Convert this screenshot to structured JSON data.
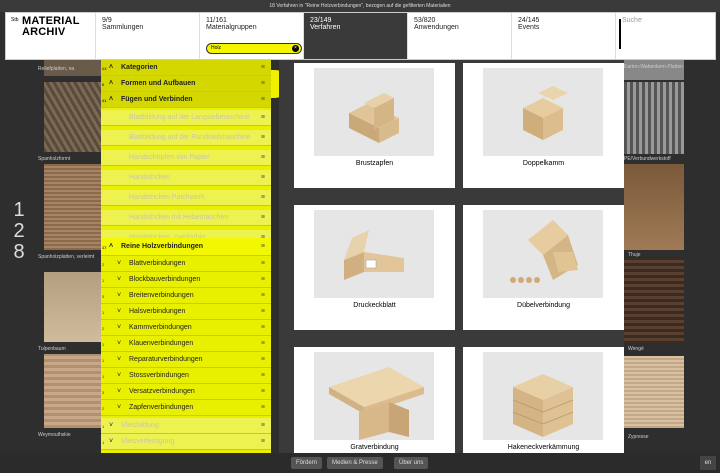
{
  "topbar": {
    "text": "18 Verfahren in \"Reine Holzverbindungen\", bezogen auf die gefilterten Materialien"
  },
  "logo": {
    "num": "Stb",
    "line1": "MATERIAL",
    "line2": "ARCHIV"
  },
  "nav": [
    {
      "count": "9/9",
      "label": "Sammlungen"
    },
    {
      "count": "11/161",
      "label": "Materialgruppen"
    },
    {
      "count": "23/149",
      "label": "Verfahren"
    },
    {
      "count": "53/820",
      "label": "Anwendungen"
    },
    {
      "count": "24/145",
      "label": "Events"
    }
  ],
  "chip": {
    "label": "Holz",
    "close": "×"
  },
  "search": {
    "placeholder": "Suche"
  },
  "left_thumbs": [
    "Reliefplatten, na",
    "Spanholzformt",
    "Spanholzplatten, verleimt",
    "Tulpenbaum",
    "Weymouthskie"
  ],
  "left_number": [
    "1",
    "2",
    "8"
  ],
  "right_thumbs": [
    "Karton-Wabenkern-Platten",
    "PE/Verbundwerkstoff",
    "Thuje",
    "Wengé",
    "Zypresse"
  ],
  "categories": [
    {
      "num": "23",
      "label": "Kategorien"
    },
    {
      "num": "6",
      "label": "Formen und Aufbauen"
    },
    {
      "num": "41",
      "label": "Fügen und Verbinden"
    },
    {
      "num": "",
      "label": "Blattbildung auf der Langsiebmaschine"
    },
    {
      "num": "",
      "label": "Blattbildung auf der Rundsiebmaschine"
    },
    {
      "num": "",
      "label": "Handschöpfen von Papier"
    },
    {
      "num": "",
      "label": "Handstricken"
    },
    {
      "num": "",
      "label": "Handstricken Patchwork"
    },
    {
      "num": "",
      "label": "Handstricken mit Hebemaschen"
    },
    {
      "num": "",
      "label": "Handstricken, zweifarbig"
    },
    {
      "num": "17",
      "label": "Reine Holzverbindungen"
    },
    {
      "num": "2",
      "label": "Blattverbindungen"
    },
    {
      "num": "1",
      "label": "Blockbauverbindungen"
    },
    {
      "num": "3",
      "label": "Breitenverbindungen"
    },
    {
      "num": "1",
      "label": "Halsverbindungen"
    },
    {
      "num": "2",
      "label": "Kammverbindungen"
    },
    {
      "num": "1",
      "label": "Klauenverbindungen"
    },
    {
      "num": "1",
      "label": "Reparaturverbindungen"
    },
    {
      "num": "1",
      "label": "Stossverbindungen"
    },
    {
      "num": "3",
      "label": "Versatzverbindungen"
    },
    {
      "num": "2",
      "label": "Zapfenverbindungen"
    },
    {
      "num": "1",
      "label": "Vliesbildung"
    },
    {
      "num": "1",
      "label": "Vliesverfestigung"
    }
  ],
  "cards": [
    "Brustzapfen",
    "Doppelkamm",
    "Druckeckblatt",
    "Dübelverbindung",
    "Gratverbindung",
    "Hakeneckverkämmung"
  ],
  "footer": {
    "btn1": "Fördern",
    "btn2": "Medien & Presse",
    "btn3": "Über uns",
    "lang": "en"
  },
  "colors": {
    "accent": "#e8f000",
    "panel_dark": "#3a3a3a"
  }
}
